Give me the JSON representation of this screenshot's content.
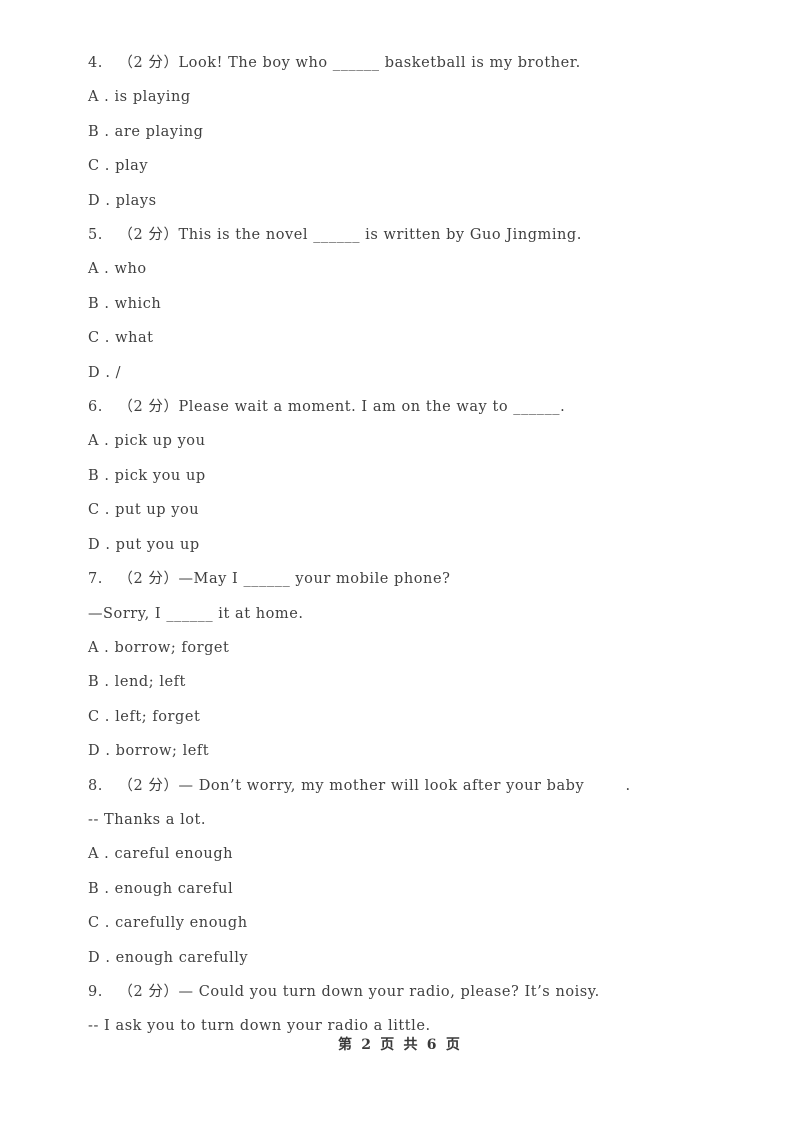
{
  "document": {
    "page_background": "#ffffff",
    "text_color": "#3f3f3f",
    "footer_text": "第 2 页 共 6 页",
    "page_number": "2",
    "total_pages": "6"
  },
  "questions": [
    {
      "number": "4.",
      "score": "（2 分）",
      "stem": "4.   （2 分）Look! The boy who ______ basketball is my brother.",
      "continuation": null,
      "options": [
        "A . is playing",
        "B . are playing",
        "C . play",
        "D . plays"
      ]
    },
    {
      "number": "5.",
      "score": "（2 分）",
      "stem": "5.   （2 分）This is the novel ______ is written by Guo Jingming.",
      "continuation": null,
      "options": [
        "A . who",
        "B . which",
        "C . what",
        "D . /"
      ]
    },
    {
      "number": "6.",
      "score": "（2 分）",
      "stem": "6.   （2 分）Please wait a moment. I am on the way to ______.",
      "continuation": null,
      "options": [
        "A . pick up you",
        "B . pick you up",
        "C . put up you",
        "D . put you up"
      ]
    },
    {
      "number": "7.",
      "score": "（2 分）",
      "stem": "7.   （2 分）—May I ______ your mobile phone?",
      "continuation": "—Sorry, I ______ it at home.",
      "options": [
        "A . borrow; forget",
        "B . lend; left",
        "C . left; forget",
        "D . borrow; left"
      ]
    },
    {
      "number": "8.",
      "score": "（2 分）",
      "stem": "8.   （2 分）— Don’t worry, my mother will look after your baby        .",
      "continuation": "-- Thanks a lot.",
      "options": [
        "A . careful enough",
        "B . enough careful",
        "C . carefully enough",
        "D . enough carefully"
      ]
    },
    {
      "number": "9.",
      "score": "（2 分）",
      "stem": "9.   （2 分）— Could you turn down your radio, please? It’s noisy.",
      "continuation": "-- I ask you to turn down your radio a little.",
      "options": []
    }
  ]
}
